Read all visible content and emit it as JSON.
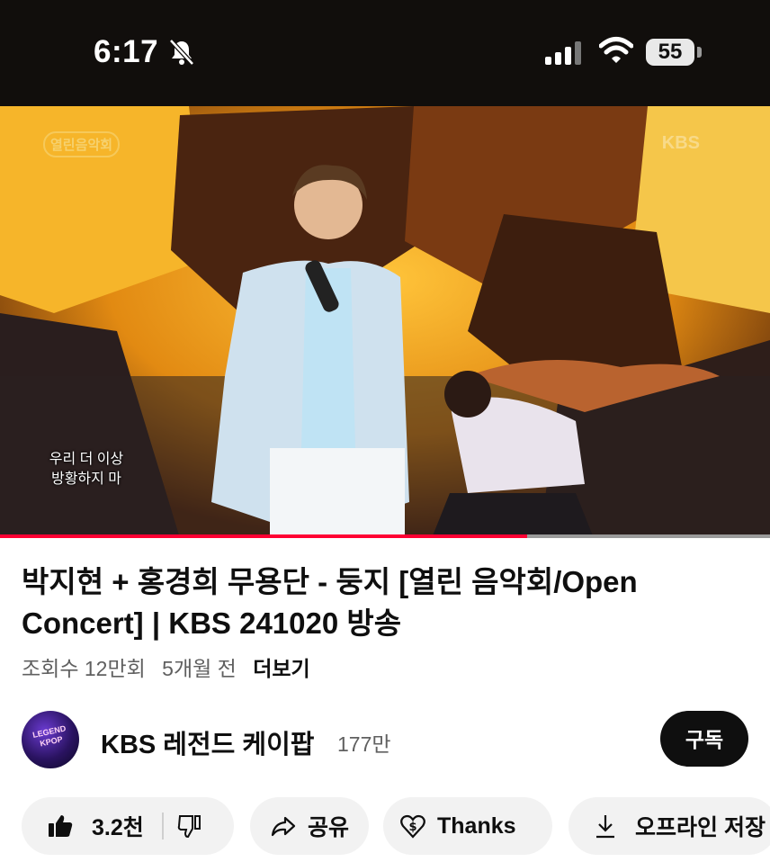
{
  "status_bar": {
    "time": "6:17",
    "battery": "55",
    "icons": [
      "bell-slash-icon",
      "cellular-signal-icon",
      "wifi-icon",
      "battery-icon"
    ]
  },
  "video": {
    "overlay_logo": "열린음악회",
    "watermark": "KBS",
    "subtitle_line1": "우리 더 이상",
    "subtitle_line2": "방황하지 마",
    "progress": 0.685,
    "colors": {
      "progress": "#ff0033"
    }
  },
  "title": "박지현 + 홍경희 무용단 - 둥지 [열린 음악회/Open Concert] | KBS 241020 방송",
  "meta": {
    "views": "조회수 12만회",
    "age": "5개월 전",
    "more": "더보기"
  },
  "channel": {
    "avatar_text": "LEGEND KPOP",
    "name": "KBS 레전드 케이팝",
    "subscribers": "177만",
    "subscribe_label": "구독"
  },
  "actions": {
    "like_count": "3.2천",
    "share_label": "공유",
    "thanks_label": "Thanks",
    "save_label": "오프라인 저장"
  }
}
